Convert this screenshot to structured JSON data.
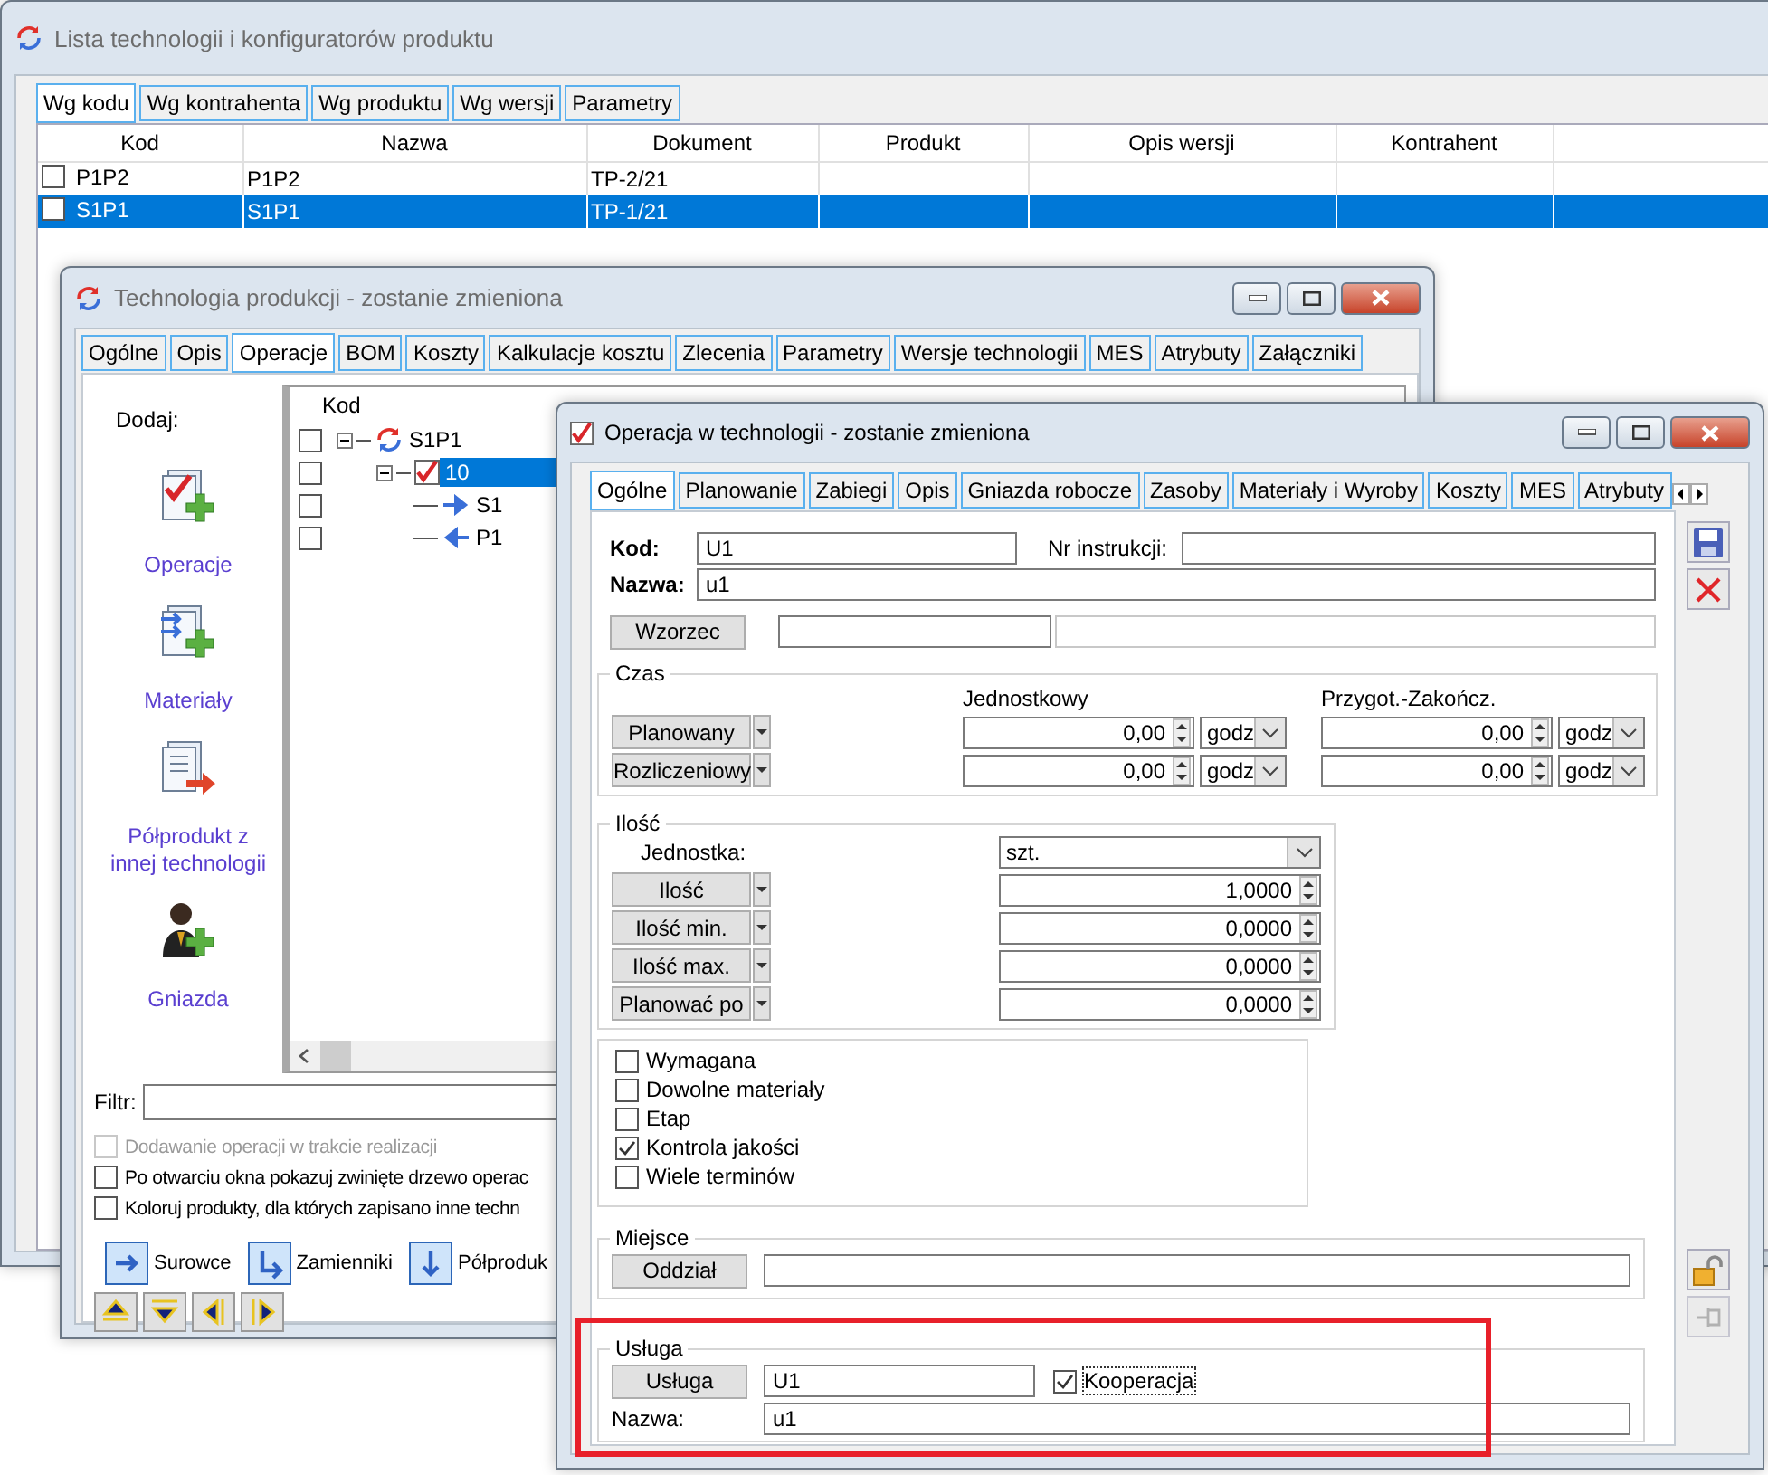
{
  "list_window": {
    "title": "Lista technologii i konfiguratorów produktu",
    "tabs": [
      {
        "label": "Wg kodu",
        "selected": true
      },
      {
        "label": "Wg kontrahenta",
        "selected": false
      },
      {
        "label": "Wg produktu",
        "selected": false
      },
      {
        "label": "Wg wersji",
        "selected": false
      },
      {
        "label": "Parametry",
        "selected": false
      }
    ],
    "columns": [
      "Kod",
      "Nazwa",
      "Dokument",
      "Produkt",
      "Opis wersji",
      "Kontrahent"
    ],
    "rows": [
      {
        "cells": [
          "P1P2",
          "P1P2",
          "TP-2/21"
        ],
        "checked": false,
        "selected": false
      },
      {
        "cells": [
          "S1P1",
          "S1P1",
          "TP-1/21"
        ],
        "checked": false,
        "selected": true
      }
    ]
  },
  "technology_window": {
    "title": "Technologia produkcji - zostanie zmieniona",
    "tabs": [
      {
        "label": "Ogólne",
        "selected": false
      },
      {
        "label": "Opis",
        "selected": false
      },
      {
        "label": "Operacje",
        "selected": true
      },
      {
        "label": "BOM",
        "selected": false
      },
      {
        "label": "Koszty",
        "selected": false
      },
      {
        "label": "Kalkulacje kosztu",
        "selected": false
      },
      {
        "label": "Zlecenia",
        "selected": false
      },
      {
        "label": "Parametry",
        "selected": false
      },
      {
        "label": "Wersje technologii",
        "selected": false
      },
      {
        "label": "MES",
        "selected": false
      },
      {
        "label": "Atrybuty",
        "selected": false
      },
      {
        "label": "Załączniki",
        "selected": false
      }
    ],
    "add_label": "Dodaj:",
    "add_items": [
      {
        "label": "Operacje",
        "kind": "operation"
      },
      {
        "label": "Materiały",
        "kind": "material"
      },
      {
        "label": "Półprodukt z innej technologii",
        "kind": "semi_product"
      },
      {
        "label": "Gniazda",
        "kind": "workstation"
      }
    ],
    "tree_header": "Kod",
    "tree": [
      {
        "label": "S1P1",
        "kind": "technology",
        "checked": false,
        "expanded": true,
        "selected": false,
        "children": [
          {
            "label": "10",
            "kind": "operation",
            "checked": false,
            "expanded": true,
            "selected": true,
            "children": [
              {
                "label": "S1",
                "kind": "input",
                "checked": false,
                "selected": false
              },
              {
                "label": "P1",
                "kind": "output",
                "checked": false,
                "selected": false
              }
            ]
          }
        ]
      }
    ],
    "filter_label": "Filtr:",
    "options": [
      {
        "label": "Dodawanie operacji w trakcie realizacji",
        "checked": false,
        "disabled": true
      },
      {
        "label": "Po otwarciu okna pokazuj zwinięte drzewo operac",
        "checked": false,
        "disabled": false
      },
      {
        "label": "Koloruj produkty, dla których zapisano inne techn",
        "checked": false,
        "disabled": false
      }
    ],
    "link_buttons": [
      {
        "label": "Surowce",
        "kind": "right"
      },
      {
        "label": "Zamienniki",
        "kind": "bent"
      },
      {
        "label": "Półproduk",
        "kind": "down"
      }
    ],
    "move_buttons": [
      {
        "kind": "up"
      },
      {
        "kind": "down"
      },
      {
        "kind": "left"
      },
      {
        "kind": "right"
      }
    ]
  },
  "operation_window": {
    "title": "Operacja w technologii - zostanie zmieniona",
    "tabs": [
      {
        "label": "Ogólne",
        "selected": true
      },
      {
        "label": "Planowanie",
        "selected": false
      },
      {
        "label": "Zabiegi",
        "selected": false
      },
      {
        "label": "Opis",
        "selected": false
      },
      {
        "label": "Gniazda robocze",
        "selected": false
      },
      {
        "label": "Zasoby",
        "selected": false
      },
      {
        "label": "Materiały i Wyroby",
        "selected": false
      },
      {
        "label": "Koszty",
        "selected": false
      },
      {
        "label": "MES",
        "selected": false
      },
      {
        "label": "Atrybuty",
        "selected": false
      }
    ],
    "code_label": "Kod:",
    "code": "U1",
    "instruction_label": "Nr instrukcji:",
    "name_label": "Nazwa:",
    "name": "u1",
    "template_button": "Wzorzec",
    "time": {
      "legend": "Czas",
      "columns": [
        "Jednostkowy",
        "Przygot.-Zakończ."
      ],
      "rows": [
        {
          "button": "Planowany",
          "values": [
            {
              "value": "0,00",
              "unit": "godz"
            },
            {
              "value": "0,00",
              "unit": "godz"
            }
          ]
        },
        {
          "button": "Rozliczeniowy",
          "values": [
            {
              "value": "0,00",
              "unit": "godz"
            },
            {
              "value": "0,00",
              "unit": "godz"
            }
          ]
        }
      ]
    },
    "quantity": {
      "legend": "Ilość",
      "unit_label": "Jednostka:",
      "unit": "szt.",
      "rows": [
        {
          "button": "Ilość",
          "value": "1,0000"
        },
        {
          "button": "Ilość min.",
          "value": "0,0000"
        },
        {
          "button": "Ilość max.",
          "value": "0,0000"
        },
        {
          "button": "Planować po",
          "value": "0,0000"
        }
      ]
    },
    "flags": [
      {
        "label": "Wymagana",
        "checked": false
      },
      {
        "label": "Dowolne materiały",
        "checked": false
      },
      {
        "label": "Etap",
        "checked": false
      },
      {
        "label": "Kontrola jakości",
        "checked": true
      },
      {
        "label": "Wiele terminów",
        "checked": false
      }
    ],
    "place": {
      "legend": "Miejsce",
      "button": "Oddział"
    },
    "service": {
      "legend": "Usługa",
      "button": "Usługa",
      "code": "U1",
      "cooperation": {
        "label": "Kooperacja",
        "checked": true
      },
      "name_label": "Nazwa:",
      "name": "u1"
    }
  }
}
